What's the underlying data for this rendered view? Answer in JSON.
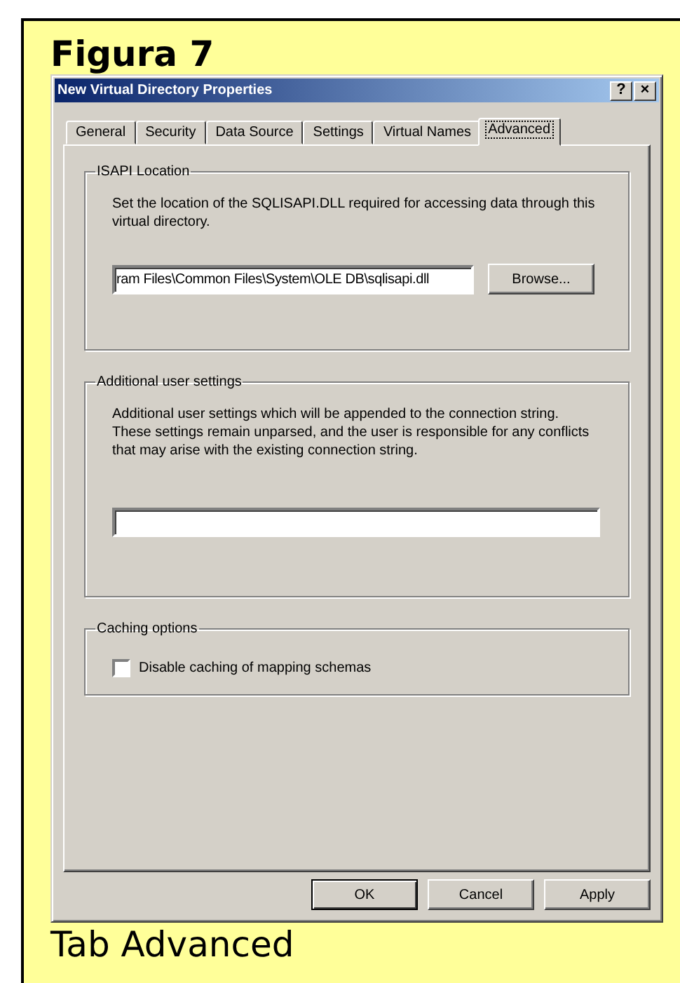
{
  "figure": {
    "heading": "Figura 7",
    "caption": "Tab Advanced"
  },
  "window": {
    "title": "New Virtual Directory Properties",
    "title_buttons": [
      "?",
      "×"
    ]
  },
  "tabs": [
    {
      "label": "General",
      "selected": false
    },
    {
      "label": "Security",
      "selected": false
    },
    {
      "label": "Data Source",
      "selected": false
    },
    {
      "label": "Settings",
      "selected": false
    },
    {
      "label": "Virtual Names",
      "selected": false
    },
    {
      "label": "Advanced",
      "selected": true
    }
  ],
  "groups": [
    {
      "kind": "path",
      "legend": "ISAPI Location",
      "description": "Set the location of the SQLISAPI.DLL required for accessing data through this virtual directory.",
      "value": "ram Files\\Common Files\\System\\OLE DB\\sqlisapi.dll",
      "button": "Browse..."
    },
    {
      "kind": "text",
      "legend": "Additional user settings",
      "description": "Additional user settings which will be appended to the connection string. These settings remain unparsed, and the user is responsible for any conflicts that may arise with the existing connection string."
    },
    {
      "kind": "checkbox",
      "legend": "Caching options",
      "checkbox": {
        "label": "Disable caching of mapping schemas",
        "checked": false
      }
    }
  ],
  "buttons": [
    {
      "label": "OK",
      "default": true
    },
    {
      "label": "Cancel",
      "default": false
    },
    {
      "label": "Apply",
      "default": false
    }
  ]
}
